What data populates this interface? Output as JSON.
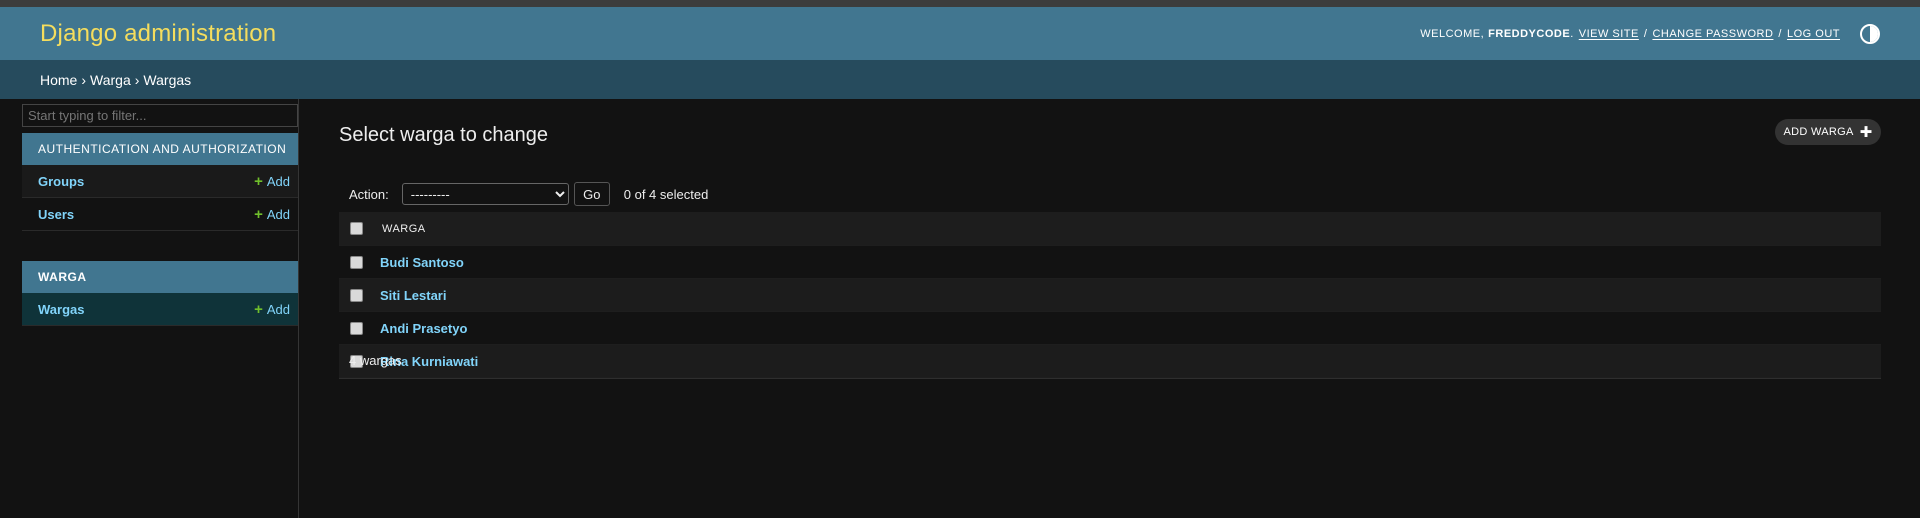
{
  "header": {
    "branding": "Django administration",
    "welcome": "Welcome,",
    "username": "FreddyCode",
    "period": ".",
    "links": {
      "view_site": "View site",
      "change_password": "Change password",
      "log_out": "Log out"
    },
    "separator": "/",
    "theme_toggle_icon": "theme-toggle-icon"
  },
  "breadcrumbs": {
    "home": "Home",
    "app": "Warga",
    "model": "Wargas",
    "separator": "›"
  },
  "sidebar": {
    "filter_placeholder": "Start typing to filter...",
    "modules": [
      {
        "caption": "Authentication and Authorization",
        "models": [
          {
            "name": "Groups",
            "add": "Add"
          },
          {
            "name": "Users",
            "add": "Add"
          }
        ]
      },
      {
        "caption": "Warga",
        "models": [
          {
            "name": "Wargas",
            "add": "Add"
          }
        ]
      }
    ]
  },
  "content": {
    "title": "Select warga to change",
    "add_button": "Add warga",
    "actions": {
      "label": "Action:",
      "selected_option": "---------",
      "go": "Go",
      "counter": "0 of 4 selected"
    },
    "table": {
      "column": "Warga",
      "rows": [
        "Budi Santoso",
        "Siti Lestari",
        "Andi Prasetyo",
        "Rina Kurniawati"
      ]
    },
    "paginator": "4 wargas"
  },
  "colors": {
    "header_bg": "#417690",
    "branding": "#f5dd5d",
    "breadcrumbs_bg": "#264b5d",
    "link": "#81d4fa",
    "add_plus": "#70bf2b",
    "page_bg": "#121212"
  }
}
